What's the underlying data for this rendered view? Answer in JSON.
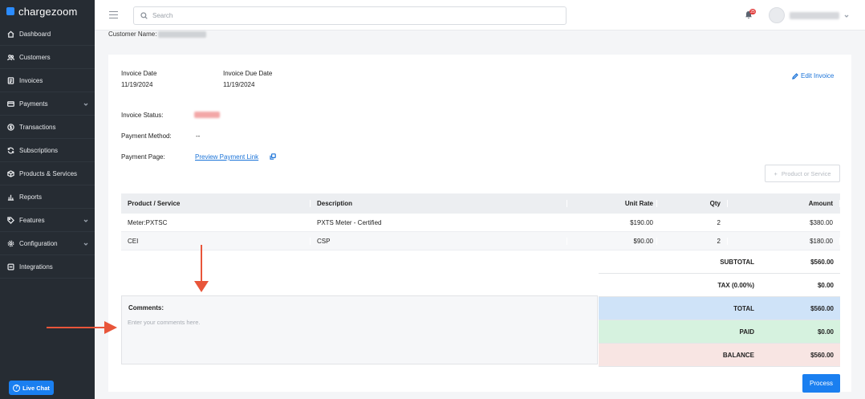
{
  "brand": {
    "name": "chargezoom"
  },
  "sidebar": {
    "items": [
      {
        "label": "Dashboard",
        "icon": "home-icon",
        "has_submenu": false
      },
      {
        "label": "Customers",
        "icon": "users-icon",
        "has_submenu": false
      },
      {
        "label": "Invoices",
        "icon": "invoice-icon",
        "has_submenu": false
      },
      {
        "label": "Payments",
        "icon": "card-icon",
        "has_submenu": true
      },
      {
        "label": "Transactions",
        "icon": "dollar-icon",
        "has_submenu": false
      },
      {
        "label": "Subscriptions",
        "icon": "refresh-icon",
        "has_submenu": false
      },
      {
        "label": "Products & Services",
        "icon": "box-icon",
        "has_submenu": false
      },
      {
        "label": "Reports",
        "icon": "bar-chart-icon",
        "has_submenu": false
      },
      {
        "label": "Features",
        "icon": "tag-icon",
        "has_submenu": true
      },
      {
        "label": "Configuration",
        "icon": "gear-icon",
        "has_submenu": true
      },
      {
        "label": "Integrations",
        "icon": "plug-icon",
        "has_submenu": false
      }
    ],
    "live_chat": "Live Chat"
  },
  "header": {
    "search_placeholder": "Search",
    "notification_count": "25"
  },
  "customer": {
    "label": "Customer Name:"
  },
  "invoice": {
    "date_label": "Invoice Date",
    "date_value": "11/19/2024",
    "due_label": "Invoice Due Date",
    "due_value": "11/19/2024",
    "edit_label": "Edit Invoice",
    "status_label": "Invoice Status:",
    "method_label": "Payment Method:",
    "method_value": "--",
    "page_label": "Payment Page:",
    "page_link": "Preview Payment Link",
    "add_product_label": "Product or Service"
  },
  "table": {
    "headers": [
      "Product / Service",
      "Description",
      "Unit Rate",
      "Qty",
      "Amount"
    ],
    "rows": [
      [
        "Meter:PXTSC",
        "PXTS Meter - Certified",
        "$190.00",
        "2",
        "$380.00"
      ],
      [
        "CEI",
        "CSP",
        "$90.00",
        "2",
        "$180.00"
      ]
    ]
  },
  "totals": {
    "subtotal_label": "SUBTOTAL",
    "subtotal_value": "$560.00",
    "tax_label": "TAX (0.00%)",
    "tax_value": "$0.00",
    "total_label": "TOTAL",
    "total_value": "$560.00",
    "paid_label": "PAID",
    "paid_value": "$0.00",
    "balance_label": "BALANCE",
    "balance_value": "$560.00"
  },
  "comments": {
    "title": "Comments:",
    "placeholder": "Enter your comments here."
  },
  "actions": {
    "process_label": "Process"
  },
  "colors": {
    "sidebar_bg": "#262c33",
    "accent": "#1a7ff0",
    "total_bg": "#cfe3f8",
    "paid_bg": "#d6f2df",
    "balance_bg": "#f8e5e3",
    "annotation_arrow": "#e8553a"
  }
}
